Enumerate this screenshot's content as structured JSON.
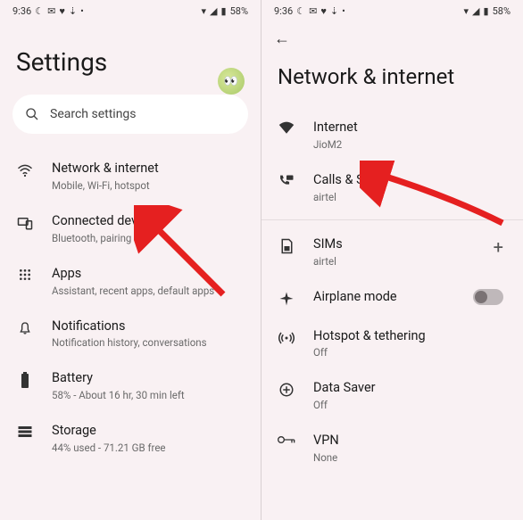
{
  "status": {
    "time": "9:36",
    "battery": "58%"
  },
  "left": {
    "title": "Settings",
    "search_placeholder": "Search settings",
    "items": [
      {
        "title": "Network & internet",
        "subtitle": "Mobile, Wi-Fi, hotspot"
      },
      {
        "title": "Connected devices",
        "subtitle": "Bluetooth, pairing"
      },
      {
        "title": "Apps",
        "subtitle": "Assistant, recent apps, default apps"
      },
      {
        "title": "Notifications",
        "subtitle": "Notification history, conversations"
      },
      {
        "title": "Battery",
        "subtitle": "58% - About 16 hr, 30 min left"
      },
      {
        "title": "Storage",
        "subtitle": "44% used - 71.21 GB free"
      }
    ]
  },
  "right": {
    "title": "Network & internet",
    "items": [
      {
        "title": "Internet",
        "subtitle": "JioM2"
      },
      {
        "title": "Calls & SMS",
        "subtitle": "airtel"
      },
      {
        "title": "SIMs",
        "subtitle": "airtel"
      },
      {
        "title": "Airplane mode",
        "subtitle": ""
      },
      {
        "title": "Hotspot & tethering",
        "subtitle": "Off"
      },
      {
        "title": "Data Saver",
        "subtitle": "Off"
      },
      {
        "title": "VPN",
        "subtitle": "None"
      }
    ]
  }
}
